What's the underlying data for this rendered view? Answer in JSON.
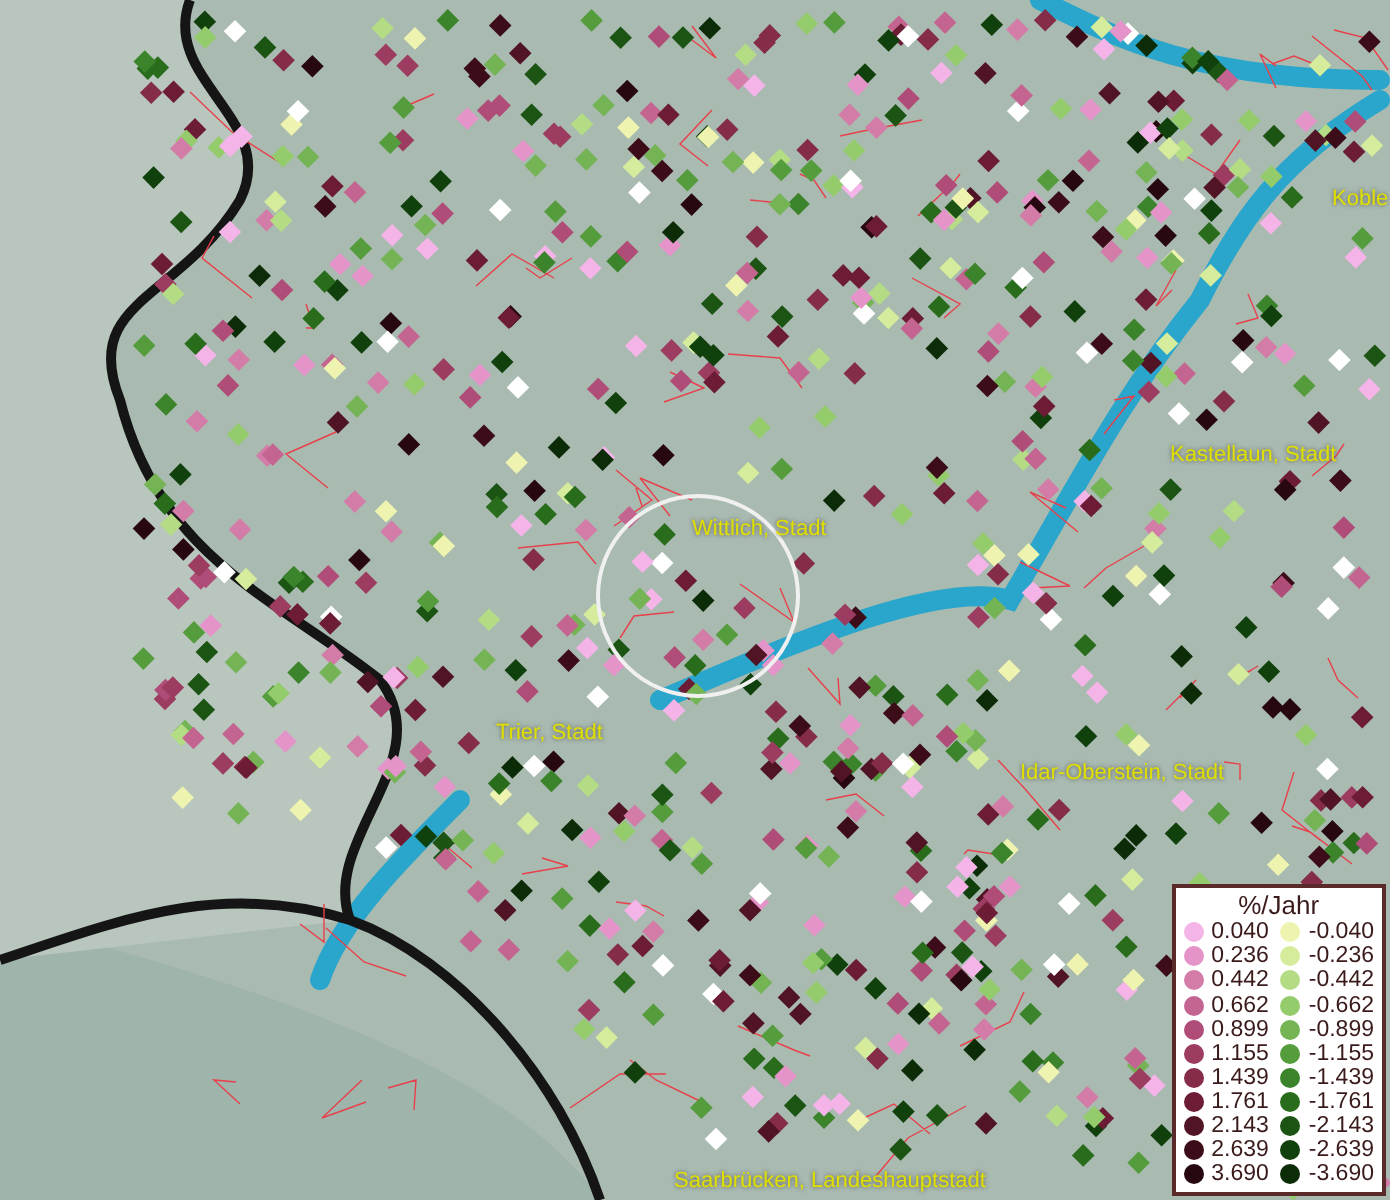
{
  "map": {
    "places": [
      {
        "name": "Koble"
      },
      {
        "name": "Kastellaun, Stadt"
      },
      {
        "name": "Wittlich, Stadt"
      },
      {
        "name": "Trier, Stadt"
      },
      {
        "name": "Idar-Oberstein, Stadt"
      },
      {
        "name": "Saarbrücken, Landeshauptstadt"
      }
    ]
  },
  "legend": {
    "title": "%/Jahr",
    "entries": [
      {
        "label": "0.040",
        "color": "#f4b4e8"
      },
      {
        "label": "-0.040",
        "color": "#eef4b0"
      },
      {
        "label": "0.236",
        "color": "#e494c8"
      },
      {
        "label": "-0.236",
        "color": "#d4ec9c"
      },
      {
        "label": "0.442",
        "color": "#d47ca8"
      },
      {
        "label": "-0.442",
        "color": "#b4dc84"
      },
      {
        "label": "0.662",
        "color": "#c46490"
      },
      {
        "label": "-0.662",
        "color": "#94cc6c"
      },
      {
        "label": "0.899",
        "color": "#b04c78"
      },
      {
        "label": "-0.899",
        "color": "#74b454"
      },
      {
        "label": "1.155",
        "color": "#9c3c60"
      },
      {
        "label": "-1.155",
        "color": "#549c3c"
      },
      {
        "label": "1.439",
        "color": "#842c48"
      },
      {
        "label": "-1.439",
        "color": "#3c842c"
      },
      {
        "label": "1.761",
        "color": "#6c1c34"
      },
      {
        "label": "-1.761",
        "color": "#286c1c"
      },
      {
        "label": "2.143",
        "color": "#501424"
      },
      {
        "label": "-2.143",
        "color": "#1c5414"
      },
      {
        "label": "2.639",
        "color": "#3c0c18"
      },
      {
        "label": "-2.639",
        "color": "#10400c"
      },
      {
        "label": "3.690",
        "color": "#280810"
      },
      {
        "label": "-3.690",
        "color": "#0c2c08"
      }
    ]
  }
}
